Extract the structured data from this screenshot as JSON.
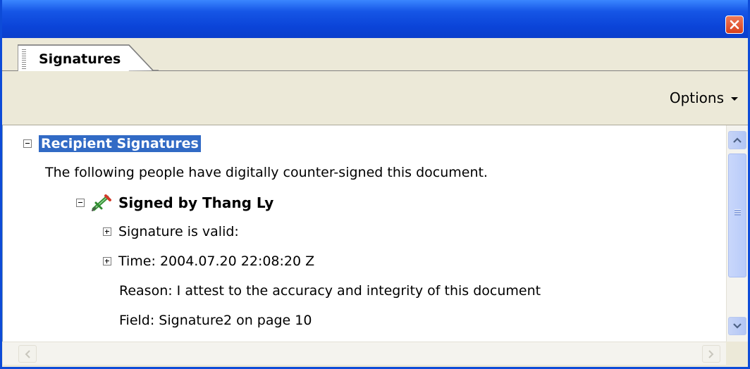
{
  "window": {
    "close_icon": "close-icon",
    "accent": "#0b44d8",
    "close_color": "#d8401c"
  },
  "tabs": [
    {
      "label": "Signatures"
    }
  ],
  "toolbar": {
    "options_label": "Options"
  },
  "tree": {
    "root_label": "Recipient Signatures",
    "description": "The following people have digitally counter-signed this document.",
    "signer_label": "Signed by Thang Ly",
    "items": [
      {
        "label": "Signature is valid:",
        "expandable": true
      },
      {
        "label": "Time: 2004.07.20 22:08:20 Z",
        "expandable": true
      },
      {
        "label": "Reason: I attest to the accuracy and integrity of this document",
        "expandable": false
      },
      {
        "label": "Field: Signature2 on page 10",
        "expandable": false
      }
    ],
    "selection_color": "#316ac5"
  }
}
